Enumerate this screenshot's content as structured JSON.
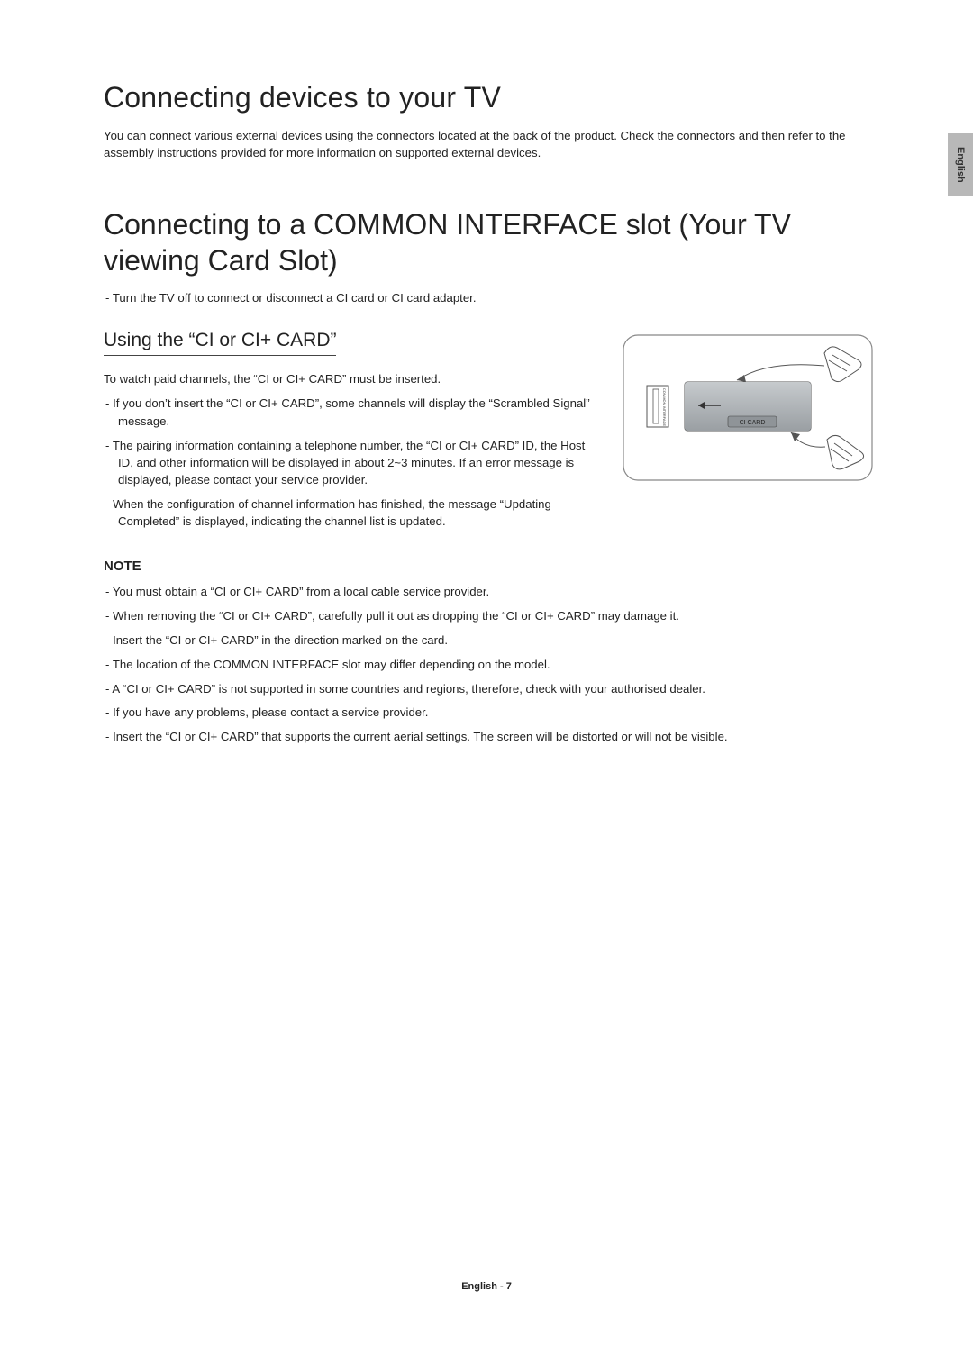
{
  "lang_tab": "English",
  "h1": "Connecting devices to your TV",
  "intro": "You can connect various external devices using the connectors located at the back of the product. Check the connectors and then refer to the assembly instructions provided for more information on supported external devices.",
  "h2": "Connecting to a COMMON INTERFACE slot (Your TV viewing Card Slot)",
  "top_bullet": "Turn the TV off to connect or disconnect a CI card or CI card adapter.",
  "h3": "Using the “CI or CI+ CARD”",
  "para1": "To watch paid channels, the “CI or CI+ CARD” must be inserted.",
  "using_items": [
    "If you don’t insert the “CI or CI+ CARD”, some channels will display the “Scrambled Signal” message.",
    "The pairing information containing a telephone number, the “CI or CI+ CARD” ID, the Host ID, and other information will be displayed in about 2~3 minutes. If an error message is displayed, please contact your service provider.",
    "When the configuration of channel information has finished, the message “Updating Completed” is displayed, indicating the channel list is updated."
  ],
  "note_head": "NOTE",
  "note_items": [
    "You must obtain a “CI or CI+ CARD” from a local cable service provider.",
    "When removing the “CI or CI+ CARD”, carefully pull it out as dropping the “CI or CI+ CARD” may damage it.",
    "Insert the “CI or CI+ CARD” in the direction marked on the card.",
    "The location of the COMMON INTERFACE slot may differ depending on the model.",
    "A “CI or CI+ CARD” is not supported in some countries and regions, therefore, check with your authorised dealer.",
    "If you have any problems, please contact a service provider.",
    "Insert the “CI or CI+ CARD” that supports the current aerial settings. The screen will be distorted or will not be visible."
  ],
  "diagram": {
    "slot_label": "COMMON INTERFACE",
    "card_label": "CI CARD"
  },
  "footer": "English - 7"
}
